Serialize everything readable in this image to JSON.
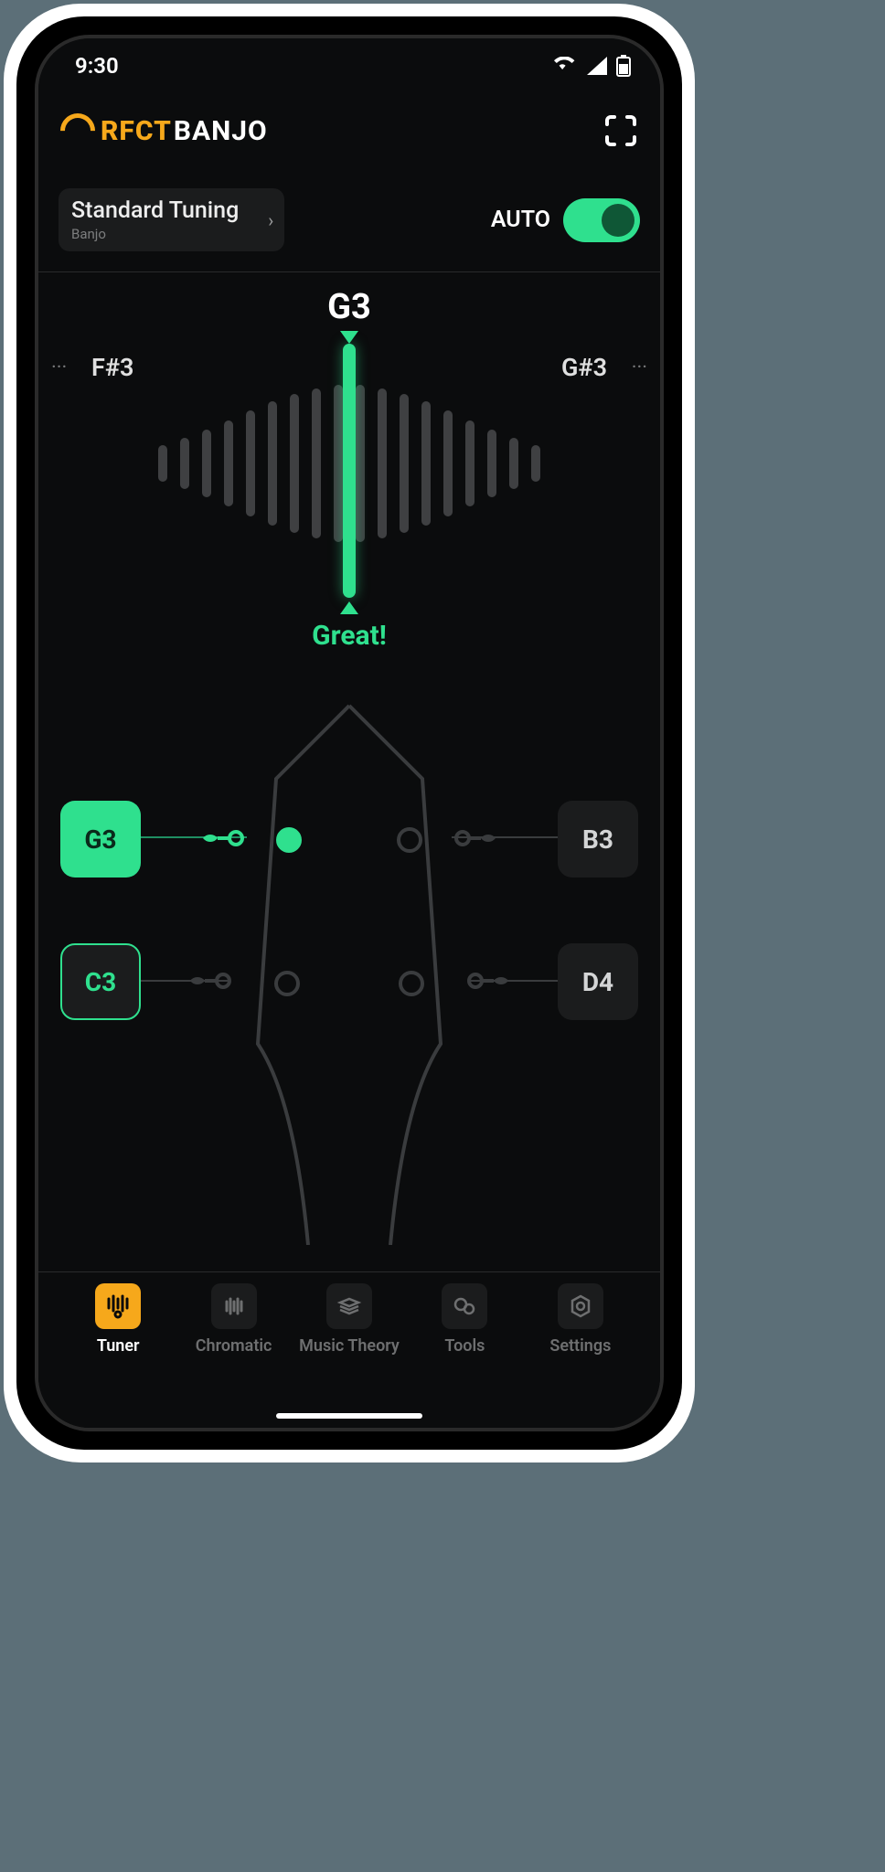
{
  "status": {
    "time": "9:30"
  },
  "brand": {
    "accent": "RFCT",
    "rest": "BANJO"
  },
  "tuning": {
    "label": "Standard Tuning",
    "sub": "Banjo"
  },
  "auto": {
    "label": "AUTO"
  },
  "meter": {
    "current": "G3",
    "low_side": "F#3",
    "high_side": "G#3",
    "side_dots": "···",
    "feedback": "Great!"
  },
  "strings": {
    "g3": "G3",
    "b3": "B3",
    "c3": "C3",
    "d4": "D4",
    "active": "g3",
    "tuned_outline": "c3"
  },
  "nav": {
    "tuner": "Tuner",
    "chromatic": "Chromatic",
    "theory": "Music Theory",
    "tools": "Tools",
    "settings": "Settings",
    "active": "tuner"
  }
}
